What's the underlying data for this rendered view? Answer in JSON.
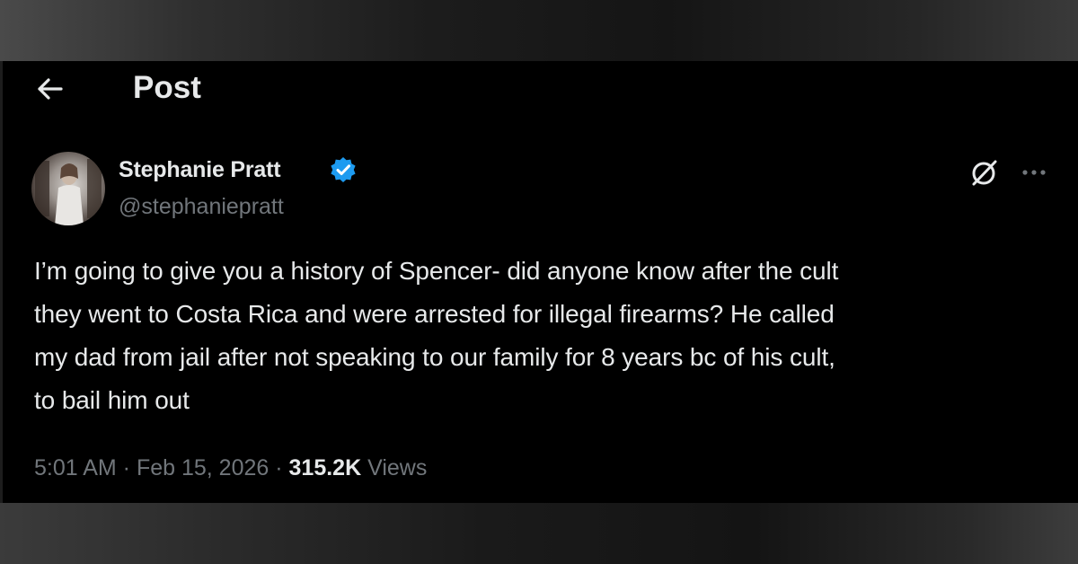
{
  "header": {
    "title": "Post",
    "back_icon": "arrow-left-icon"
  },
  "post": {
    "author": {
      "name": "Stephanie Pratt",
      "handle": "@stephaniepratt",
      "verified_icon": "verified-badge-icon",
      "verified_color": "#1d9bf0"
    },
    "actions": {
      "grok_icon": "grok-icon",
      "more_icon": "more-horizontal-icon"
    },
    "text_lines": [
      "I’m going to give you a history of Spencer- did anyone know after the cult",
      "they went to Costa Rica and were arrested for illegal firearms? He called",
      "my dad from jail after not speaking to our family for 8 years bc of his cult,",
      "to bail him out"
    ],
    "meta": {
      "time": "5:01 AM",
      "separator": " · ",
      "date": "Feb 15, 2026",
      "views_count": "315.2K",
      "views_label": "Views"
    }
  },
  "colors": {
    "background": "#000000",
    "primary_text": "#e7e9ea",
    "secondary_text": "#71767b",
    "accent": "#1d9bf0"
  }
}
